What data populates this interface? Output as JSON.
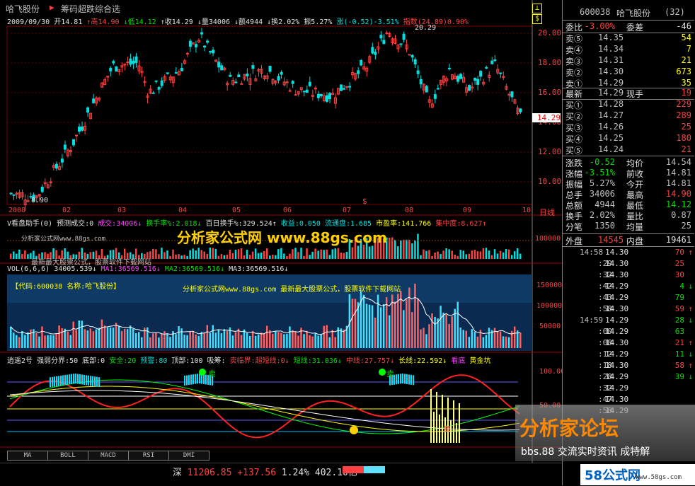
{
  "window": {
    "stock_name": "哈飞股份",
    "title_marker": "▶",
    "title": "筹码超跌综合选",
    "icon1": "⊥",
    "icon2": "$"
  },
  "info": {
    "date": "2009/09/30",
    "open": "开14.81",
    "high": "↑高14.90",
    "low": "↓低14.12",
    "close": "↑收14.29",
    "vol": "↓量34006",
    "amt": "↓额4944",
    "turnover": "↓换2.02%",
    "amp": "振5.27%",
    "change": "涨(-0.52)-3.51%",
    "index": "指数(24.89)0.90%"
  },
  "price_axis": {
    "labels": [
      "20.00",
      "18.00",
      "16.00",
      "14.00",
      "12.00",
      "10.00"
    ],
    "current": "14.29"
  },
  "price_annotations": {
    "max": "20.29",
    "min": "8.90",
    "dollar": "$"
  },
  "date_axis": {
    "labels": [
      "2008",
      "02",
      "03",
      "04",
      "05",
      "06",
      "07",
      "08",
      "09",
      "10"
    ],
    "unit": "日线"
  },
  "panel1": {
    "title": "V看盘助手(0) 预测成交:0",
    "items": [
      {
        "t": "成交:34006↓",
        "c": "magenta"
      },
      {
        "t": "换手率%:2.018↓",
        "c": "green"
      },
      {
        "t": "百日换手%:329.524↑",
        "c": "white"
      },
      {
        "t": "收益:0.050",
        "c": "cyan"
      },
      {
        "t": "流通盘:1.685",
        "c": "cyan"
      },
      {
        "t": "市盈率:141.766",
        "c": "yellow"
      },
      {
        "t": "集中度:8.627↑",
        "c": "red"
      }
    ],
    "axis": "100000",
    "watermark": "最新最大股票公式，股票软件下载网站",
    "site_label": "分析家公式网www.88gs.com"
  },
  "panel2": {
    "title": "VOL(6,6,6)",
    "v": "34005.539↓",
    "ma1": "MA1:36569.516↓",
    "ma2": "MA2:36569.516↓",
    "ma3": "MA3:36569.516↓",
    "code_line": "【代码:600038 名称:哈飞股份】",
    "watermark": "分析家公式网www.88gs.com 最新最大股票公式，股票软件下载网站",
    "axis": [
      "150000",
      "100000",
      "50000"
    ]
  },
  "panel3": {
    "title": "逍遥2号",
    "items": [
      {
        "t": "强弱分界:50",
        "c": "white"
      },
      {
        "t": "底部:0",
        "c": "white"
      },
      {
        "t": "安全:20",
        "c": "green"
      },
      {
        "t": "预警:80",
        "c": "cyan"
      },
      {
        "t": "顶部:100",
        "c": "white"
      },
      {
        "t": "吸筹:",
        "c": "white"
      },
      {
        "t": "卖临界:超短线:0↓",
        "c": "red"
      },
      {
        "t": "短线:31.036↓",
        "c": "green"
      },
      {
        "t": "中线:27.757↓",
        "c": "red"
      },
      {
        "t": "长线:22.592↓",
        "c": "yellow"
      },
      {
        "t": "看底",
        "c": "magenta"
      },
      {
        "t": "黄金坑",
        "c": "yellow"
      }
    ],
    "axis": [
      "100.00",
      "50.00"
    ],
    "sell": "卖",
    "sell2": "卖",
    "sell3": "卖"
  },
  "big_watermark": "分析家公式网 www.88gs.com",
  "tabs": [
    "MA",
    "BOLL",
    "MACD",
    "RSI",
    "DMI"
  ],
  "status": {
    "market": "深",
    "index": "11206.85",
    "change": "+137.56",
    "pct": "1.24%",
    "amount": "402.10亿"
  },
  "quote": {
    "code": "600038",
    "name": "哈飞股份",
    "count": "(32)",
    "weibi_label": "委比",
    "weibi": "-3.00%",
    "weicha_label": "委差",
    "weicha": "-46",
    "sells": [
      {
        "l": "卖⑤",
        "p": "14.35",
        "v": "54"
      },
      {
        "l": "卖④",
        "p": "14.34",
        "v": "7"
      },
      {
        "l": "卖③",
        "p": "14.31",
        "v": "21"
      },
      {
        "l": "卖②",
        "p": "14.30",
        "v": "673"
      },
      {
        "l": "卖①",
        "p": "14.29",
        "v": "35"
      }
    ],
    "latest_label": "最新",
    "latest": "14.29",
    "cur_label": "现手",
    "cur": "19",
    "buys": [
      {
        "l": "买①",
        "p": "14.28",
        "v": "229"
      },
      {
        "l": "买②",
        "p": "14.27",
        "v": "289"
      },
      {
        "l": "买③",
        "p": "14.26",
        "v": "25"
      },
      {
        "l": "买④",
        "p": "14.25",
        "v": "180"
      },
      {
        "l": "买⑤",
        "p": "14.24",
        "v": "21"
      }
    ],
    "stats": [
      {
        "l1": "涨跌",
        "v1": "-0.52",
        "l2": "均价",
        "v2": "14.54",
        "c1": "green",
        "c2": "gray"
      },
      {
        "l1": "涨幅",
        "v1": "-3.51%",
        "l2": "前收",
        "v2": "14.81",
        "c1": "green",
        "c2": "gray"
      },
      {
        "l1": "振幅",
        "v1": "5.27%",
        "l2": "今开",
        "v2": "14.81",
        "c1": "gray",
        "c2": "gray"
      },
      {
        "l1": "总手",
        "v1": "34006",
        "l2": "最高",
        "v2": "14.90",
        "c1": "gray",
        "c2": "red"
      },
      {
        "l1": "总额",
        "v1": "4944",
        "l2": "最低",
        "v2": "14.12",
        "c1": "gray",
        "c2": "green"
      },
      {
        "l1": "换手",
        "v1": "2.02%",
        "l2": "量比",
        "v2": "0.87",
        "c1": "gray",
        "c2": "gray"
      },
      {
        "l1": "分笔",
        "v1": "1350",
        "l2": "均量",
        "v2": "25",
        "c1": "gray",
        "c2": "gray"
      }
    ],
    "outer_label": "外盘",
    "outer": "14545",
    "inner_label": "内盘",
    "inner": "19461",
    "ticks": [
      {
        "t": "14:58",
        "p": "14.30",
        "v": "70",
        "a": "↑",
        "c": "red"
      },
      {
        "t": ":29",
        "p": "14.30",
        "v": "25",
        "a": "",
        "c": "red"
      },
      {
        "t": ":32",
        "p": "14.30",
        "v": "30",
        "a": "",
        "c": "red"
      },
      {
        "t": ":42",
        "p": "14.29",
        "v": "4",
        "a": "↓",
        "c": "green"
      },
      {
        "t": ":43",
        "p": "14.29",
        "v": "79",
        "a": "",
        "c": "green"
      },
      {
        "t": ":58",
        "p": "14.30",
        "v": "59",
        "a": "↑",
        "c": "red"
      },
      {
        "t": "14:59",
        "p": "14.29",
        "v": "28",
        "a": "↓",
        "c": "green"
      },
      {
        "t": ":00",
        "p": "14.29",
        "v": "63",
        "a": "",
        "c": "green"
      },
      {
        "t": ":08",
        "p": "14.30",
        "v": "21",
        "a": "↑",
        "c": "red"
      },
      {
        "t": ":12",
        "p": "14.29",
        "v": "11",
        "a": "↓",
        "c": "green"
      },
      {
        "t": ":18",
        "p": "14.30",
        "v": "58",
        "a": "↑",
        "c": "red"
      },
      {
        "t": ":28",
        "p": "14.29",
        "v": "39",
        "a": "↓",
        "c": "green"
      },
      {
        "t": ":32",
        "p": "14.29",
        "v": "",
        "a": "",
        "c": "green"
      },
      {
        "t": ":47",
        "p": "14.30",
        "v": "",
        "a": "",
        "c": "red"
      },
      {
        "t": ":58",
        "p": "14.29",
        "v": "",
        "a": "",
        "c": "green"
      }
    ]
  },
  "forum": {
    "title": "分析家论坛",
    "sub": "bbs.88 交流实时资讯 成特解"
  },
  "wm58": {
    "title": "58公式网",
    "url": "www.58gs.com"
  },
  "colors": {
    "up": "#ff4040",
    "down": "#00e0e0",
    "grid": "#800000",
    "bg": "#000000"
  }
}
